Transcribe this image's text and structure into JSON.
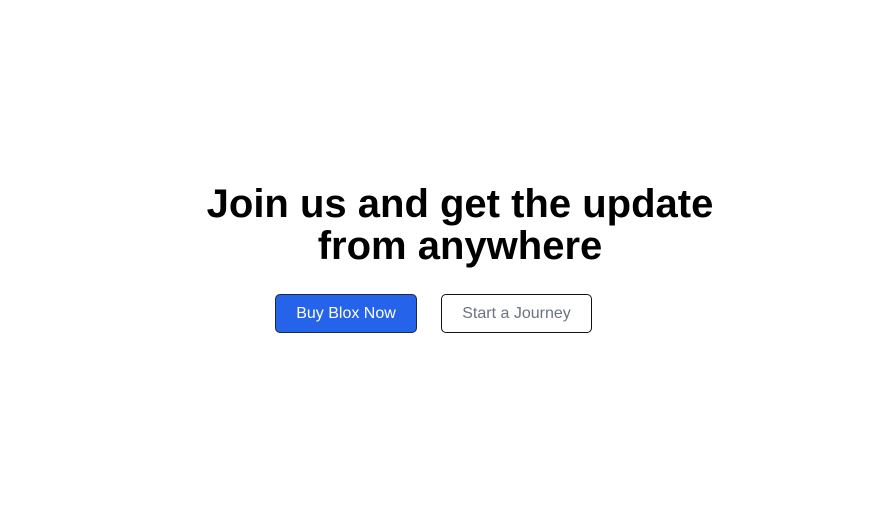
{
  "hero": {
    "headline_line1": "Join us and get the update",
    "headline_line2": "from anywhere",
    "primary_button_label": "Buy Blox Now",
    "secondary_button_label": "Start a Journey"
  },
  "colors": {
    "primary_button_bg": "#2563eb",
    "primary_button_text": "#ffffff",
    "secondary_button_text": "#6b7280",
    "headline_text": "#000000",
    "page_bg": "#ffffff"
  }
}
